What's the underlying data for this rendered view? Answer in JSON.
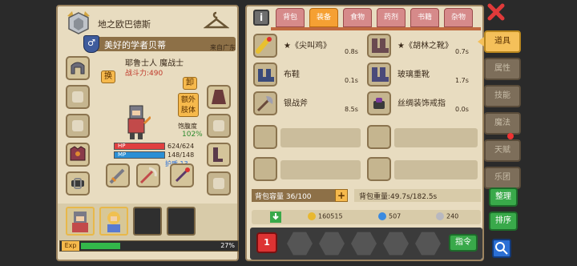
{
  "player": {
    "name": "地之欧巴德斯",
    "title": "美好的学者贝蒂",
    "title_symbol": "♂",
    "location": "来自广东",
    "class_line": "耶鲁士人 魔战士",
    "power": "战斗力:490",
    "swap_label": "换",
    "unequip_label": "卸",
    "extra_limb_label": "额外肢体",
    "hunger_label": "饱腹度",
    "hunger_value": "102%",
    "hp_label": "HP",
    "hp_value": "624/624",
    "mp_label": "MP",
    "mp_value": "148/148",
    "armor": "护盾 13"
  },
  "exp": {
    "label": "Exp",
    "percent_text": "27%",
    "fraction": 0.27
  },
  "bag": {
    "tabs": [
      "背包",
      "装备",
      "食物",
      "药剂",
      "书籍",
      "杂物"
    ],
    "active_tab": 1,
    "items": [
      {
        "name": "★《尖叫鸡》",
        "weight": "0.8s"
      },
      {
        "name": "★《胡林之靴》",
        "weight": "0.7s"
      },
      {
        "name": "布鞋",
        "weight": "0.1s"
      },
      {
        "name": "玻璃重靴",
        "weight": "1.7s"
      },
      {
        "name": "银战斧",
        "weight": "8.5s"
      },
      {
        "name": "丝绸装饰戒指",
        "weight": "0.0s"
      }
    ],
    "capacity": "背包容量 36/100",
    "capacity_plus": "+",
    "weight": "背包重量:49.7s/182.5s"
  },
  "currency": {
    "gold": "160515",
    "gems": "507",
    "silver": "240"
  },
  "actions": {
    "number_badge": "1",
    "command_label": "指令"
  },
  "side_menu": {
    "items": [
      "道具",
      "属性",
      "技能",
      "魔法",
      "天赋",
      "乐团"
    ],
    "active_index": 0,
    "arrange_label": "整理",
    "sort_label": "排序"
  },
  "colors": {
    "panel_bg": "#e8dcc0",
    "panel_border": "#9c8460",
    "active_tab": "#f5a033",
    "inactive_tab": "#d68a8a",
    "hp": "#e04040",
    "mp": "#2b8fd4",
    "exp": "#33b84a",
    "green_button": "#39a94a"
  }
}
